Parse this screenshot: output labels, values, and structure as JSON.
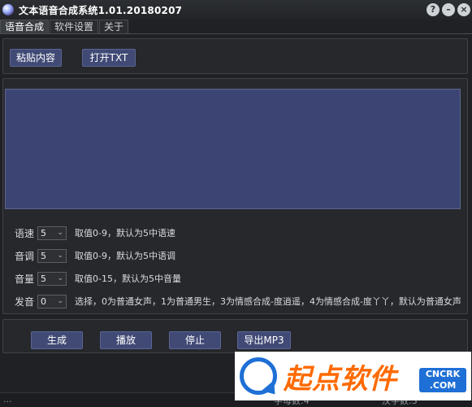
{
  "window": {
    "title": "文本语音合成系统1.01.20180207",
    "buttons": {
      "help": "?",
      "minimize": "–",
      "close": "×"
    }
  },
  "tabs": [
    {
      "label": "语音合成",
      "active": true
    },
    {
      "label": "软件设置",
      "active": false
    },
    {
      "label": "关于",
      "active": false
    }
  ],
  "top_buttons": {
    "paste": "粘贴内容",
    "open_txt": "打开TXT"
  },
  "text_content": "",
  "settings": [
    {
      "label": "语速",
      "value": "5",
      "desc": "取值0-9，默认为5中语速"
    },
    {
      "label": "音调",
      "value": "5",
      "desc": "取值0-9，默认为5中语调"
    },
    {
      "label": "音量",
      "value": "5",
      "desc": "取值0-15，默认为5中音量"
    },
    {
      "label": "发音",
      "value": "0",
      "desc": "选择，0为普通女声，1为普通男生，3为情感合成-度逍遥，4为情感合成-度丫丫，默认为普通女声"
    }
  ],
  "actions": {
    "generate": "生成",
    "play": "播放",
    "stop": "停止",
    "export": "导出MP3"
  },
  "status": {
    "left": "...",
    "letters": "字母数:4",
    "chinese": "汉字数:3"
  },
  "watermark": {
    "text": "起点软件",
    "badge_top": "CNCRK",
    "badge_bottom": ".COM"
  },
  "colors": {
    "accent": "#414a75",
    "text_area": "#3c4473",
    "background": "#1f2124"
  }
}
